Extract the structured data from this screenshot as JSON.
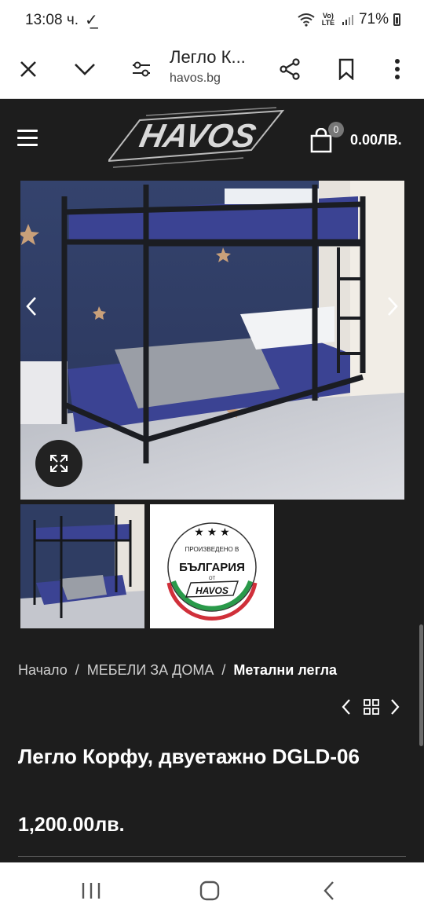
{
  "status": {
    "time": "13:08 ч.",
    "lte": "Vo) LTE",
    "battery": "71%"
  },
  "browser": {
    "title": "Легло К...",
    "url": "havos.bg",
    "icons": [
      "close-icon",
      "chevron-down-icon",
      "site-settings-icon",
      "share-icon",
      "bookmark-icon",
      "more-icon"
    ]
  },
  "header": {
    "logo_text": "HAVOS",
    "cart_count": "0",
    "cart_total": "0.00ЛВ."
  },
  "badge": {
    "line1": "ПРОИЗВЕДЕНО В",
    "line2": "БЪЛГАРИЯ",
    "line3": "ОТ",
    "line4": "HAVOS"
  },
  "breadcrumb": {
    "home": "Начало",
    "category": "МЕБЕЛИ ЗА ДОМА",
    "current": "Метални легла",
    "separator": "/"
  },
  "product": {
    "title": "Легло Корфу, двуетажно DGLD-06",
    "price": "1,200.00лв."
  },
  "colors": {
    "page_bg": "#1d1d1d",
    "wall": "#2f3d63",
    "bedding": "#3a3f8c",
    "badge_red": "#d0303a",
    "badge_green": "#2a9a4a"
  }
}
